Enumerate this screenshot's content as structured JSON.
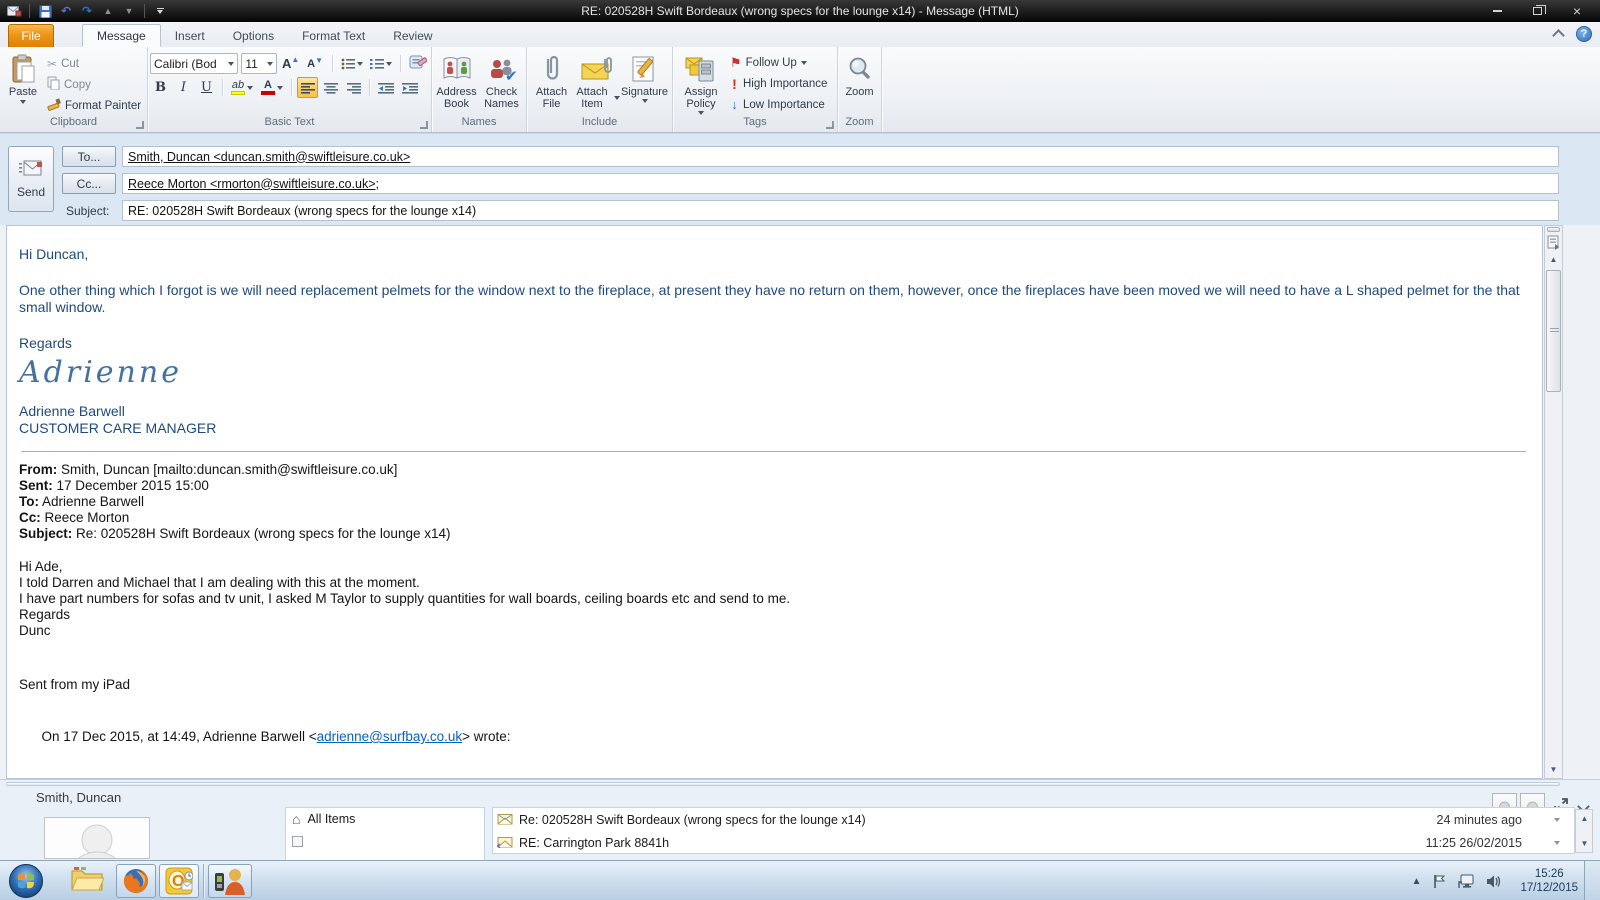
{
  "colors": {
    "title_bar": "#000000",
    "file_tab_orange": "#ef9417",
    "ribbon_selected_orange": "#fbce63",
    "header_panel_blue": "#dce7f4",
    "message_text_blue": "#1f497d",
    "link_blue": "#0563c1",
    "highlight_yellow": "#ffff00",
    "font_color_red": "#d00000",
    "flag_red": "#c83232",
    "importance_red": "#d02828",
    "importance_blue": "#3a6fd8",
    "taskbar_blue": "#c6d8ea"
  },
  "icons": {
    "scissors": "✂",
    "envelope": "✉",
    "check": "✔",
    "flag": "⚑",
    "house": "⌂",
    "up_triangle": "▲",
    "down_triangle": "▼",
    "undo": "↶",
    "redo": "↷",
    "help": "?",
    "close": "×",
    "high_importance": "!",
    "low_importance": "↓"
  },
  "window": {
    "title": "RE: 020528H Swift Bordeaux (wrong specs for the lounge x14)  -  Message (HTML)"
  },
  "ribbon": {
    "tabs": [
      "File",
      "Message",
      "Insert",
      "Options",
      "Format Text",
      "Review"
    ],
    "active_tab": "Message",
    "groups": {
      "clipboard": {
        "label": "Clipboard",
        "paste": "Paste",
        "cut": "Cut",
        "copy": "Copy",
        "format_painter": "Format Painter"
      },
      "basic_text": {
        "label": "Basic Text",
        "font_name": "Calibri (Bod",
        "font_size": "11",
        "grow_font": "A",
        "shrink_font": "A",
        "bold": "B",
        "italic": "I",
        "underline": "U",
        "highlight": "ab",
        "font_color": "A"
      },
      "names": {
        "label": "Names",
        "address_book": "Address Book",
        "check_names": "Check Names"
      },
      "include": {
        "label": "Include",
        "attach_file": "Attach File",
        "attach_item": "Attach Item",
        "signature": "Signature"
      },
      "tags": {
        "label": "Tags",
        "assign_policy": "Assign Policy",
        "follow_up": "Follow Up",
        "high_importance": "High Importance",
        "low_importance": "Low Importance"
      },
      "zoom": {
        "label": "Zoom",
        "zoom": "Zoom"
      }
    }
  },
  "envelope": {
    "send": "Send",
    "to_button": "To...",
    "cc_button": "Cc...",
    "subject_label": "Subject:",
    "to_value": "Smith, Duncan <duncan.smith@swiftleisure.co.uk>",
    "cc_value": "Reece Morton <rmorton@swiftleisure.co.uk>;",
    "subject_value": "RE: 020528H Swift Bordeaux (wrong specs for the lounge x14)"
  },
  "message": {
    "greeting": "Hi Duncan,",
    "paragraph": "One other thing which I forgot is we will need replacement pelmets for the window next to the fireplace, at present they have no return on them, however, once the fireplaces have been moved we will need to have a L shaped pelmet for the that small window.",
    "regards": "Regards",
    "signature_script": "Adrienne",
    "signature_name": "Adrienne Barwell",
    "signature_role": "CUSTOMER CARE MANAGER",
    "quoted_header": {
      "from_label": "From:",
      "from_value": " Smith, Duncan [mailto:duncan.smith@swiftleisure.co.uk]",
      "sent_label": "Sent:",
      "sent_value": " 17 December 2015 15:00",
      "to_label": "To:",
      "to_value": " Adrienne Barwell",
      "cc_label": "Cc:",
      "cc_value": " Reece Morton",
      "subject_label": "Subject:",
      "subject_value": " Re: 020528H Swift Bordeaux (wrong specs for the lounge x14)"
    },
    "quoted_body": {
      "line1": "Hi Ade,",
      "line2": "I told Darren and Michael that I am dealing with this at the moment.",
      "line3": "I have part numbers for sofas and tv unit, I asked M Taylor to supply quantities for wall boards, ceiling boards etc and send to me.",
      "line4": "Regards",
      "line5": "Dunc",
      "sent_from": "Sent from my iPad",
      "reply_intro_pre": "On 17 Dec 2015, at 14:49, Adrienne Barwell <",
      "reply_link": "adrienne@surfbay.co.uk",
      "reply_intro_post": "> wrote:"
    }
  },
  "people_pane": {
    "contact_name": "Smith, Duncan",
    "nav": {
      "all_items": "All Items"
    },
    "emails": [
      {
        "subject": "Re: 020528H Swift Bordeaux (wrong specs for the lounge x14)",
        "time": "24 minutes ago"
      },
      {
        "subject": "RE: Carrington Park 8841h",
        "time": "11:25 26/02/2015"
      }
    ]
  },
  "taskbar": {
    "time": "15:26",
    "date": "17/12/2015"
  }
}
